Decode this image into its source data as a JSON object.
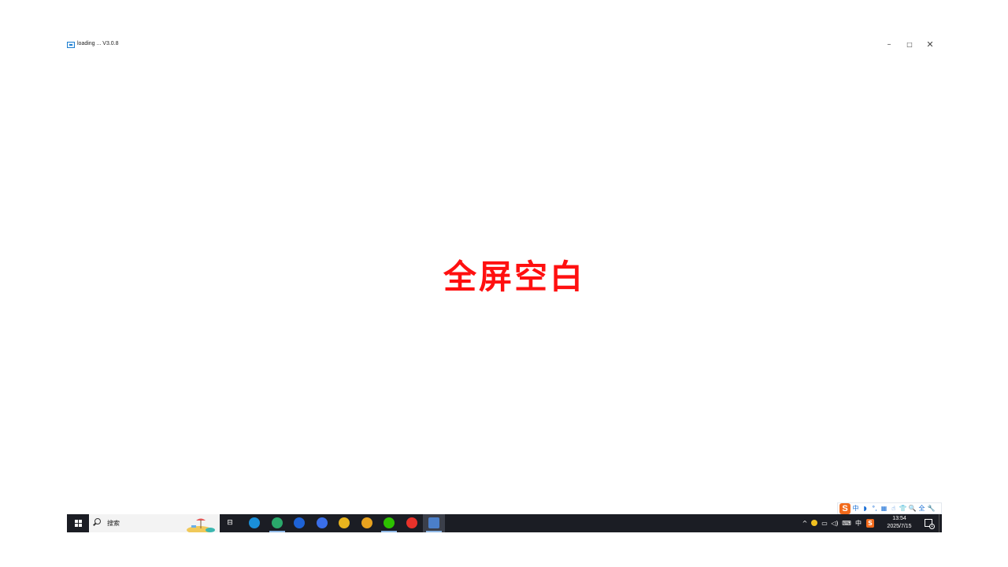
{
  "window": {
    "title": "loading ... V3.0.8",
    "minimize_glyph": "–",
    "maximize_glyph": "□",
    "close_glyph": "✕"
  },
  "content": {
    "message": "全屏空白",
    "message_color": "#ff1010"
  },
  "ime_toolbar": {
    "logo": "S",
    "items": [
      "中",
      "◗",
      "°,",
      "▦",
      "☝",
      "👕",
      "🔍",
      "全",
      "🔧"
    ]
  },
  "taskbar": {
    "search_placeholder": "搜索",
    "apps": [
      {
        "icon": "edge-icon",
        "color": "#1a8fd8",
        "running": false,
        "active": false
      },
      {
        "icon": "edge-beta-icon",
        "color": "#2aa96b",
        "running": true,
        "active": false
      },
      {
        "icon": "meeting-app-icon",
        "color": "#1e63d6",
        "running": false,
        "active": false
      },
      {
        "icon": "browser-app-icon",
        "color": "#3a6ee8",
        "running": false,
        "active": false
      },
      {
        "icon": "chrome-icon",
        "color": "#e8b41e",
        "running": false,
        "active": false
      },
      {
        "icon": "chrome-canary-icon",
        "color": "#e8a21e",
        "running": false,
        "active": false
      },
      {
        "icon": "wechat-icon",
        "color": "#2dc100",
        "running": true,
        "active": false
      },
      {
        "icon": "wps-icon",
        "color": "#e8322a",
        "running": false,
        "active": false
      },
      {
        "icon": "loading-app-icon",
        "color": "#4b7fc9",
        "running": true,
        "active": true
      }
    ]
  },
  "tray": {
    "chevron": "^",
    "ime_mode": "中",
    "ime_logo": "S",
    "time": "13:54",
    "date": "2025/7/15",
    "notification_count": "1"
  }
}
